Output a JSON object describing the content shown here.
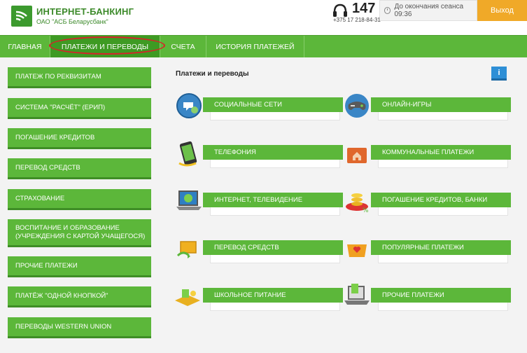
{
  "header": {
    "brand_title": "ИНТЕРНЕТ-БАНКИНГ",
    "brand_sub": "ОАО \"АСБ Беларусбанк\"",
    "phone_short": "147",
    "phone_long": "+375 17 218-84-31",
    "session_text": "До окончания сеанса 09:36",
    "logout_label": "Выход",
    "accent": "#f0a928"
  },
  "nav": {
    "items": [
      {
        "label": "ГЛАВНАЯ"
      },
      {
        "label": "ПЛАТЕЖИ И ПЕРЕВОДЫ"
      },
      {
        "label": "СЧЕТА"
      },
      {
        "label": "ИСТОРИЯ ПЛАТЕЖЕЙ"
      }
    ],
    "active_index": 1,
    "color": "#5cb73a"
  },
  "sidebar": {
    "items": [
      {
        "label": "ПЛАТЕЖ ПО РЕКВИЗИТАМ"
      },
      {
        "label": "СИСТЕМА \"РАСЧЁТ\" (ЕРИП)"
      },
      {
        "label": "ПОГАШЕНИЕ КРЕДИТОВ"
      },
      {
        "label": "ПЕРЕВОД СРЕДСТВ"
      },
      {
        "label": "СТРАХОВАНИЕ"
      },
      {
        "label": "ВОСПИТАНИЕ И ОБРАЗОВАНИЕ (УЧРЕЖДЕНИЯ С КАРТОЙ УЧАЩЕГОСЯ)"
      },
      {
        "label": "ПРОЧИЕ ПЛАТЕЖИ"
      },
      {
        "label": "ПЛАТЁЖ \"ОДНОЙ КНОПКОЙ\""
      },
      {
        "label": "ПЕРЕВОДЫ WESTERN UNION"
      }
    ]
  },
  "content": {
    "title": "Платежи и переводы",
    "info_label": "i",
    "tiles": [
      {
        "label": "СОЦИАЛЬНЫЕ СЕТИ",
        "icon": "social-networks-icon"
      },
      {
        "label": "ОНЛАЙН-ИГРЫ",
        "icon": "gamepad-icon"
      },
      {
        "label": "ТЕЛЕФОНИЯ",
        "icon": "smartphone-icon"
      },
      {
        "label": "КОММУНАЛЬНЫЕ ПЛАТЕЖИ",
        "icon": "house-icon"
      },
      {
        "label": "ИНТЕРНЕТ, ТЕЛЕВИДЕНИЕ",
        "icon": "laptop-globe-icon"
      },
      {
        "label": "ПОГАШЕНИЕ КРЕДИТОВ, БАНКИ",
        "icon": "coins-icon"
      },
      {
        "label": "ПЕРЕВОД СРЕДСТВ",
        "icon": "money-transfer-icon"
      },
      {
        "label": "ПОПУЛЯРНЫЕ ПЛАТЕЖИ",
        "icon": "heart-box-icon"
      },
      {
        "label": "ШКОЛЬНОЕ ПИТАНИЕ",
        "icon": "school-food-icon"
      },
      {
        "label": "ПРОЧИЕ ПЛАТЕЖИ",
        "icon": "laptop-receipt-icon"
      }
    ]
  }
}
